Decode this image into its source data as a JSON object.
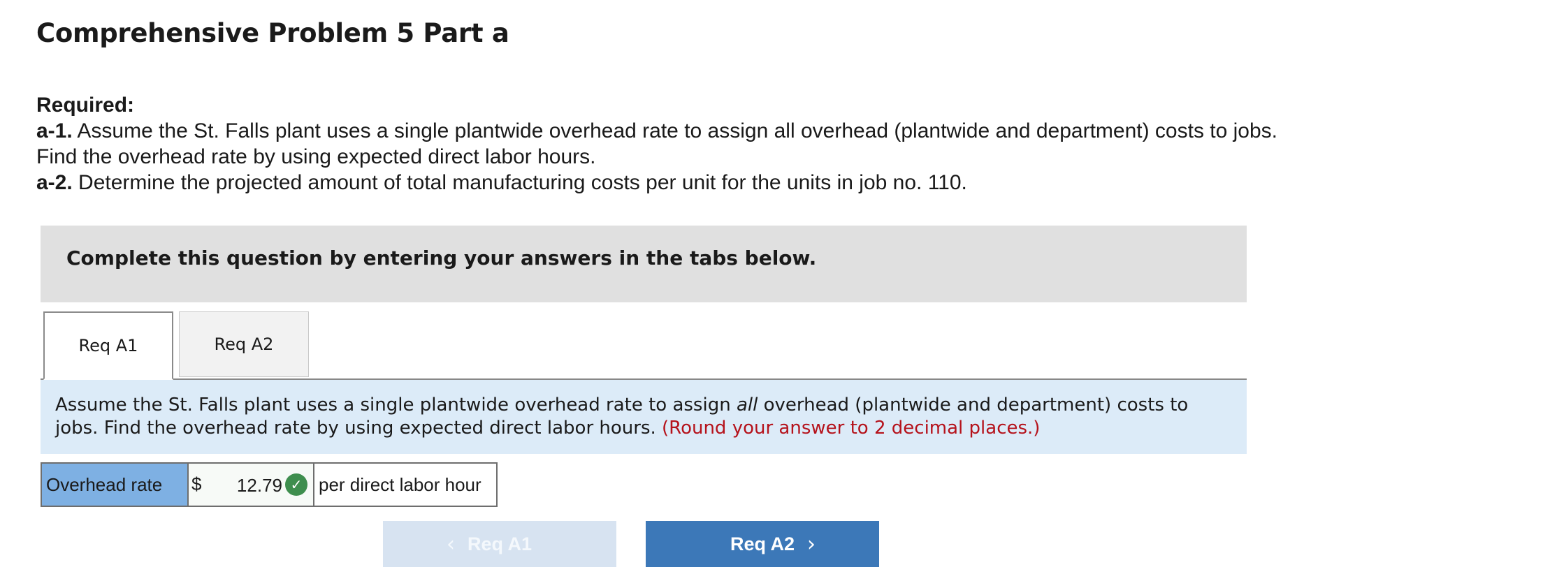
{
  "page": {
    "title": "Comprehensive Problem 5 Part a"
  },
  "required": {
    "heading": "Required:",
    "a1_label": "a-1.",
    "a1_text_line1": " Assume the St. Falls plant uses a single plantwide overhead rate to assign all overhead (plantwide and department) costs to jobs.",
    "a1_text_line2": "Find the overhead rate by using expected direct labor hours.",
    "a2_label": "a-2.",
    "a2_text": " Determine the projected amount of total manufacturing costs per unit for the units in job no. 110."
  },
  "instruction": {
    "text": "Complete this question by entering your answers in the tabs below."
  },
  "tabs": [
    {
      "label": "Req A1",
      "active": true
    },
    {
      "label": "Req A2",
      "active": false
    }
  ],
  "question": {
    "text_before": "Assume the St. Falls plant uses a single plantwide overhead rate to assign ",
    "emphasis": "all",
    "text_after": " overhead (plantwide and department) costs to jobs. Find the overhead rate by using expected direct labor hours. ",
    "hint": "(Round your answer to 2 decimal places.)"
  },
  "answer": {
    "label": "Overhead rate",
    "currency": "$",
    "value": "12.79",
    "status": "correct",
    "status_icon": "checkmark-icon",
    "unit": "per direct labor hour"
  },
  "nav": {
    "prev_label": "Req A1",
    "next_label": "Req A2",
    "prev_enabled": false,
    "next_enabled": true,
    "prev_icon": "chevron-left-icon",
    "next_icon": "chevron-right-icon"
  },
  "colors": {
    "accent": "#3c78b8",
    "tab_panel_bg": "#dcebf8",
    "label_cell_bg": "#7eb0e3",
    "hint": "#b5121b",
    "correct": "#3e8e4e"
  }
}
